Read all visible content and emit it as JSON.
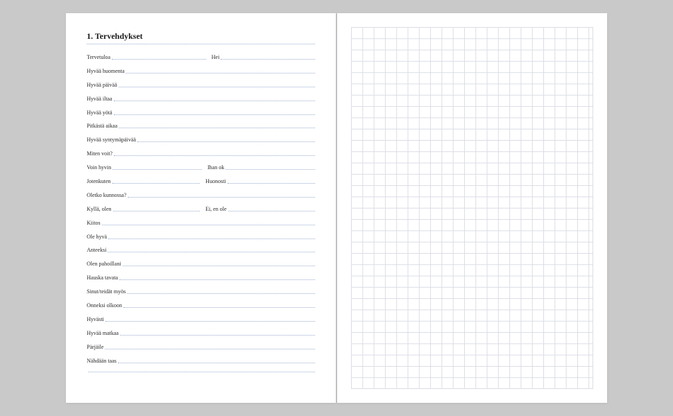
{
  "title": "1. Tervehdykset",
  "rows": [
    {
      "a": "Tervetuloa",
      "b": "Hei"
    },
    {
      "a": "Hyvää huomenta"
    },
    {
      "a": "Hyvää päivää"
    },
    {
      "a": "Hyvää iltaa"
    },
    {
      "a": "Hyvää yötä"
    },
    {
      "a": "Pitkästä aikaa"
    },
    {
      "a": "Hyvää syntymäpäivää"
    },
    {
      "a": "Miten voit?"
    },
    {
      "a": "Voin hyvin",
      "b": "Ihan ok"
    },
    {
      "a": "Jotenkuten",
      "b": "Huonosti"
    },
    {
      "a": "Oletko kunnossa?"
    },
    {
      "a": "Kyllä, olen",
      "b": "Ei, en ole"
    },
    {
      "a": "Kiitos"
    },
    {
      "a": "Ole hyvä"
    },
    {
      "a": "Anteeksi"
    },
    {
      "a": "Olen pahoillani"
    },
    {
      "a": "Hauska tavata"
    },
    {
      "a": "Sinut/teidät myös"
    },
    {
      "a": "Onneksi olkoon"
    },
    {
      "a": "Hyvästi"
    },
    {
      "a": "Hyvää matkaa"
    },
    {
      "a": "Pärjäile"
    },
    {
      "a": "Nähdään taas"
    },
    {
      "a": ""
    }
  ]
}
